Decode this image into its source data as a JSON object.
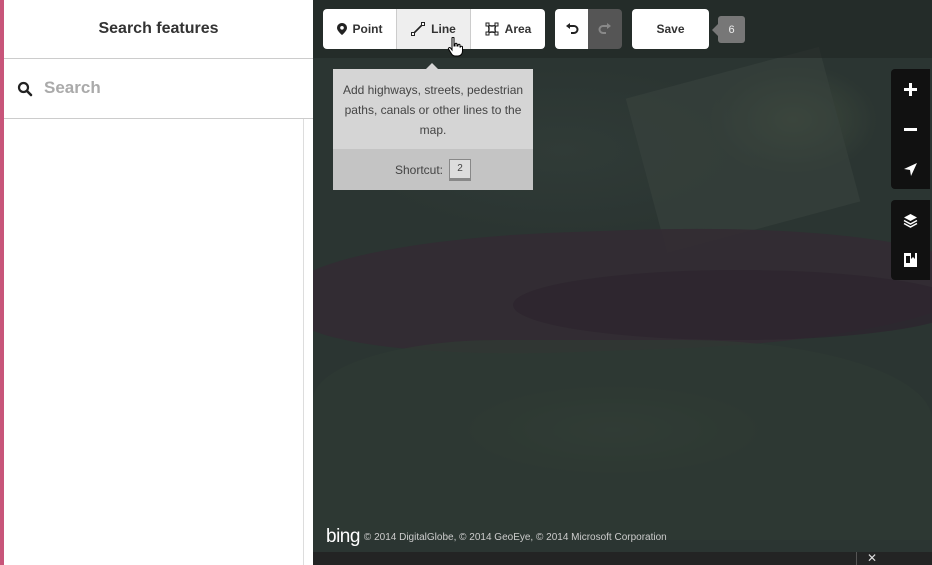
{
  "sidebar": {
    "title": "Search features",
    "search_placeholder": "Search"
  },
  "toolbar": {
    "point_label": "Point",
    "line_label": "Line",
    "area_label": "Area",
    "save_label": "Save",
    "edit_count": "6"
  },
  "tooltip": {
    "text": "Add highways, streets, pedestrian paths, canals or other lines to the map.",
    "shortcut_label": "Shortcut:",
    "shortcut_key": "2"
  },
  "attribution": {
    "logo": "bing",
    "text": "© 2014 DigitalGlobe, © 2014 GeoEye, © 2014 Microsoft Corporation"
  },
  "colors": {
    "accent_left_edge": "#c8557a",
    "map_control_bg": "#111111",
    "tooltip_bg": "#d5d5d5"
  }
}
